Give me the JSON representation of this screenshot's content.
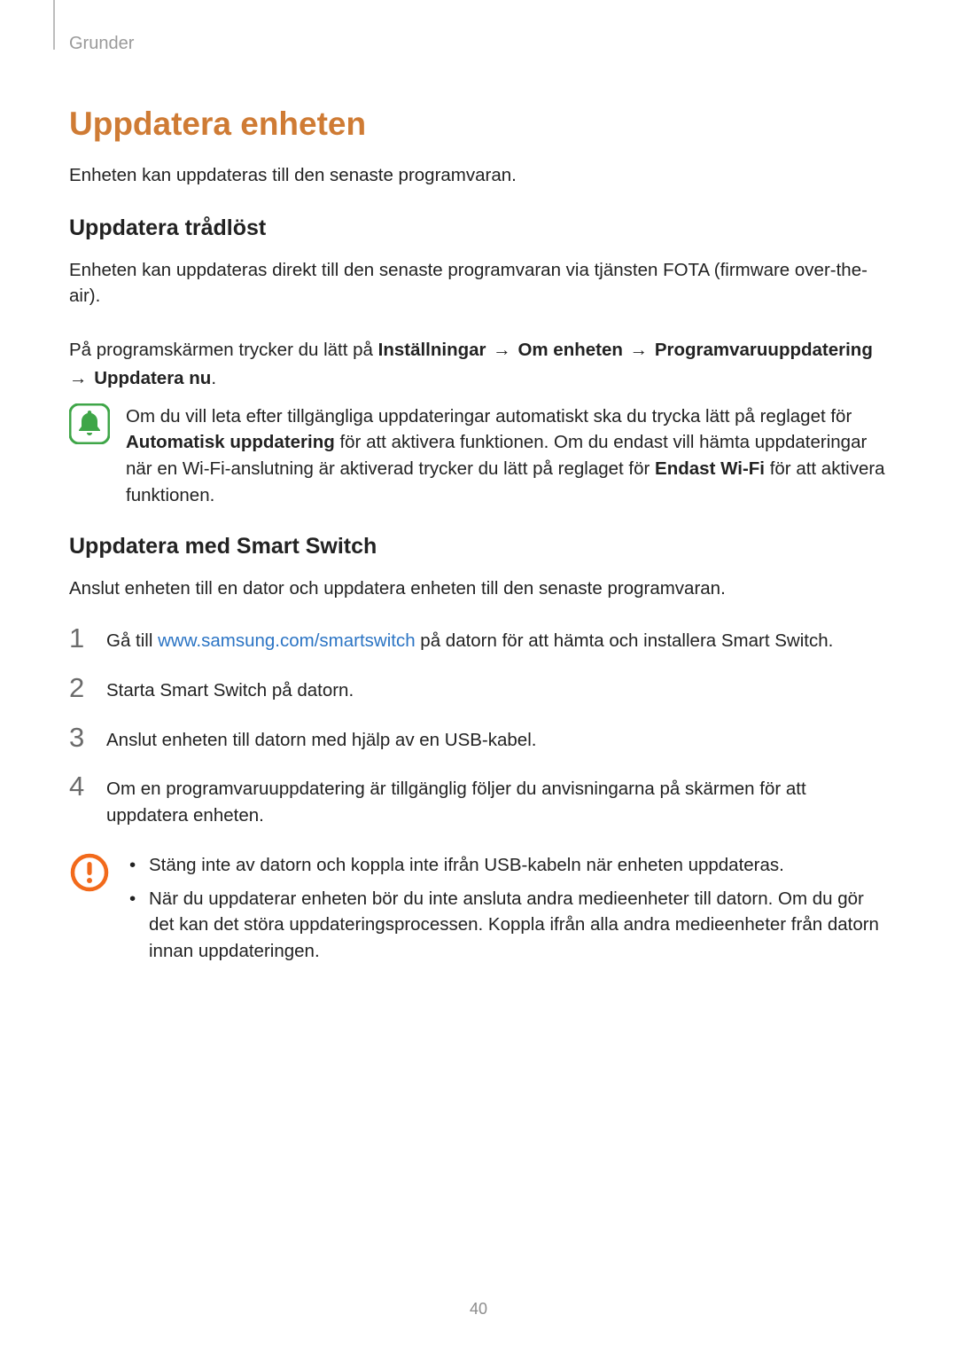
{
  "breadcrumb": "Grunder",
  "title": "Uppdatera enheten",
  "intro": "Enheten kan uppdateras till den senaste programvaran.",
  "section1": {
    "heading": "Uppdatera trådlöst",
    "p1": "Enheten kan uppdateras direkt till den senaste programvaran via tjänsten FOTA (firmware over-the-air).",
    "nav_intro": "På programskärmen trycker du lätt på ",
    "nav_b1": "Inställningar",
    "nav_b2": "Om enheten",
    "nav_b3": "Programvaruuppdatering",
    "nav_b4": "Uppdatera nu",
    "arrow": " → ",
    "period": ".",
    "note_pre": "Om du vill leta efter tillgängliga uppdateringar automatiskt ska du trycka lätt på reglaget för ",
    "note_b1": "Automatisk uppdatering",
    "note_mid": " för att aktivera funktionen. Om du endast vill hämta uppdateringar när en Wi-Fi-anslutning är aktiverad trycker du lätt på reglaget för ",
    "note_b2": "Endast Wi-Fi",
    "note_post": " för att aktivera funktionen."
  },
  "section2": {
    "heading": "Uppdatera med Smart Switch",
    "p1": "Anslut enheten till en dator och uppdatera enheten till den senaste programvaran.",
    "steps": {
      "n1": "1",
      "s1_pre": "Gå till ",
      "s1_link": "www.samsung.com/smartswitch",
      "s1_post": " på datorn för att hämta och installera Smart Switch.",
      "n2": "2",
      "s2": "Starta Smart Switch på datorn.",
      "n3": "3",
      "s3": "Anslut enheten till datorn med hjälp av en USB-kabel.",
      "n4": "4",
      "s4": "Om en programvaruuppdatering är tillgänglig följer du anvisningarna på skärmen för att uppdatera enheten."
    },
    "warn": {
      "bullet": "•",
      "w1": "Stäng inte av datorn och koppla inte ifrån USB-kabeln när enheten uppdateras.",
      "w2": "När du uppdaterar enheten bör du inte ansluta andra medieenheter till datorn. Om du gör det kan det störa uppdateringsprocessen. Koppla ifrån alla andra medieenheter från datorn innan uppdateringen."
    }
  },
  "page_number": "40"
}
